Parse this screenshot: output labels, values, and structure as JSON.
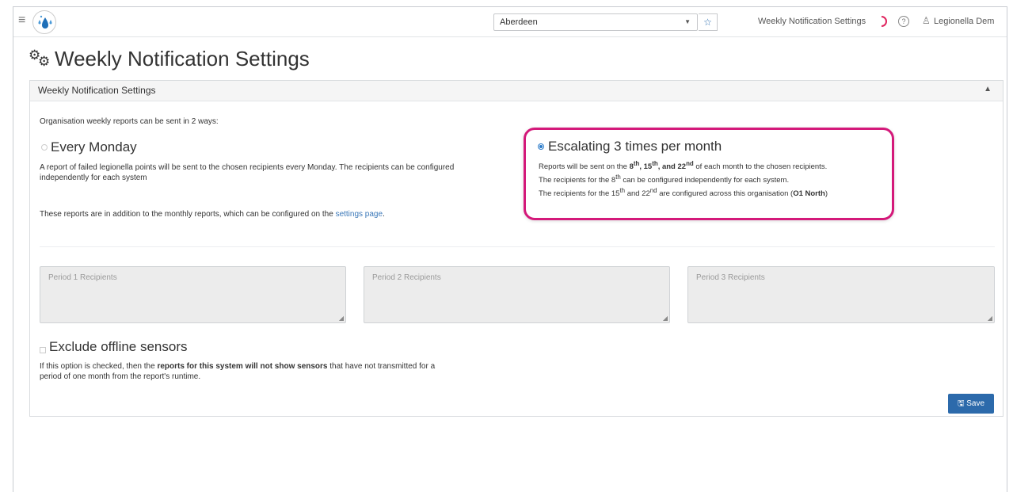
{
  "topbar": {
    "site_select_value": "Aberdeen",
    "star_icon": "star-icon",
    "nav_title": "Weekly Notification Settings",
    "user_name": "Legionella Dem"
  },
  "page": {
    "title": "Weekly Notification Settings"
  },
  "panel": {
    "header": "Weekly Notification Settings",
    "intro": "Organisation weekly reports can be sent in 2 ways:",
    "option_monday": {
      "title": "Every Monday",
      "selected": false,
      "desc_line1": "A report of failed legionella points will be sent to the chosen recipients every Monday. The recipients can be configured",
      "desc_line2": "independently for each system",
      "note_prefix": "These reports are in addition to the monthly reports, which can be configured on the",
      "note_link": "settings page",
      "note_suffix": "."
    },
    "option_escalating": {
      "title": "Escalating 3 times per month",
      "selected": true,
      "line1_prefix": "Reports will be sent on the",
      "d8": "8",
      "d15": "15",
      "d22": "22",
      "sup_th": "th",
      "sup_nd": "nd",
      "comma": ",",
      "and": ", and",
      "line1_suffix": "of each month to the chosen recipients.",
      "line2_prefix": "The recipients for the",
      "line2_suffix": "can be configured independently for each system.",
      "line3_prefix": "The recipients for the",
      "line3_mid": "and",
      "line3_suffix": "are configured across this organisation (",
      "org_name": "O1 North",
      "close_paren": ")"
    },
    "recipients": [
      {
        "placeholder": "Period 1 Recipients"
      },
      {
        "placeholder": "Period 2 Recipients"
      },
      {
        "placeholder": "Period 3 Recipients"
      }
    ],
    "exclude": {
      "title": "Exclude offline sensors",
      "checked": false,
      "desc_prefix": "If this option is checked, then the",
      "desc_bold": "reports for this system will not show sensors",
      "desc_suffix": "that have not transmitted for a",
      "desc_line2": "period of one month from the report's runtime."
    },
    "save_label": "Save"
  },
  "colors": {
    "accent": "#2c6aab",
    "highlight": "#d4197a",
    "link": "#3a77b8"
  }
}
